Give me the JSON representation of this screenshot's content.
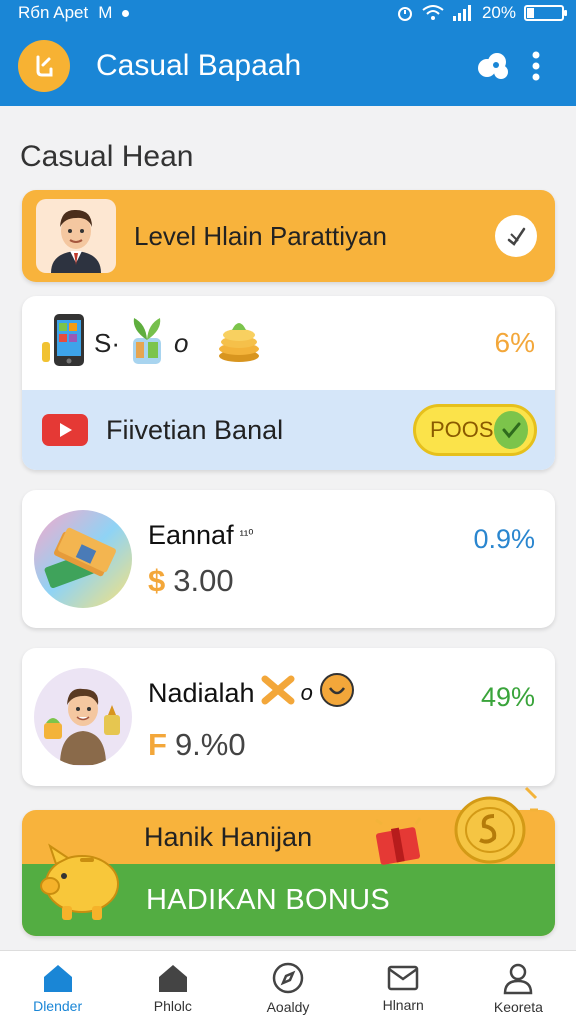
{
  "status_bar": {
    "left_text": "Rбn Apet",
    "network": "M",
    "battery": "20%",
    "battery_level": 0.2
  },
  "app_bar": {
    "title": "Casual Bapaah",
    "logo_icon": "bolt-logo-icon",
    "actions": [
      "cloud-icon",
      "more-vert-icon"
    ]
  },
  "section_title": "Casual Hean",
  "level_card": {
    "label": "Level Hlain Parattiyan",
    "action_icon": "check-icon"
  },
  "combo_card": {
    "items": [
      {
        "icon": "phone-icon"
      },
      {
        "text": "S·"
      },
      {
        "icon": "plant-icon"
      },
      {
        "text": "o"
      },
      {
        "icon": "coins-icon"
      }
    ],
    "percent": "6%",
    "banner": {
      "label": "Fiivetian Banal",
      "button_label": "POOS",
      "icon": "youtube-icon"
    }
  },
  "rewards": [
    {
      "name": "Eannaf",
      "sup": "¹¹⁰",
      "currency": "$",
      "amount": "3.00",
      "percent": "0.9%",
      "percent_color": "#2a86cf",
      "image_icon": "money-stack-icon"
    },
    {
      "name": "Nadialah",
      "currency": "F",
      "amount": "9.%0",
      "percent": "49%",
      "percent_color": "#3aa43b",
      "image_icon": "person-money-icon",
      "extra": "o"
    }
  ],
  "bonus": {
    "title": "Hanik Hanijan",
    "button_label": "HADIKAN BONUS"
  },
  "bottom_nav": [
    {
      "label": "Dlender",
      "icon": "home-icon",
      "active": true
    },
    {
      "label": "Phlolc",
      "icon": "house-icon",
      "active": false
    },
    {
      "label": "Aoaldy",
      "icon": "compass-icon",
      "active": false
    },
    {
      "label": "Hlnarn",
      "icon": "mail-icon",
      "active": false
    },
    {
      "label": "Keoreta",
      "icon": "profile-icon",
      "active": false
    }
  ],
  "colors": {
    "primary": "#1a86d6",
    "accent": "#f8b33c",
    "green": "#53ad42"
  }
}
